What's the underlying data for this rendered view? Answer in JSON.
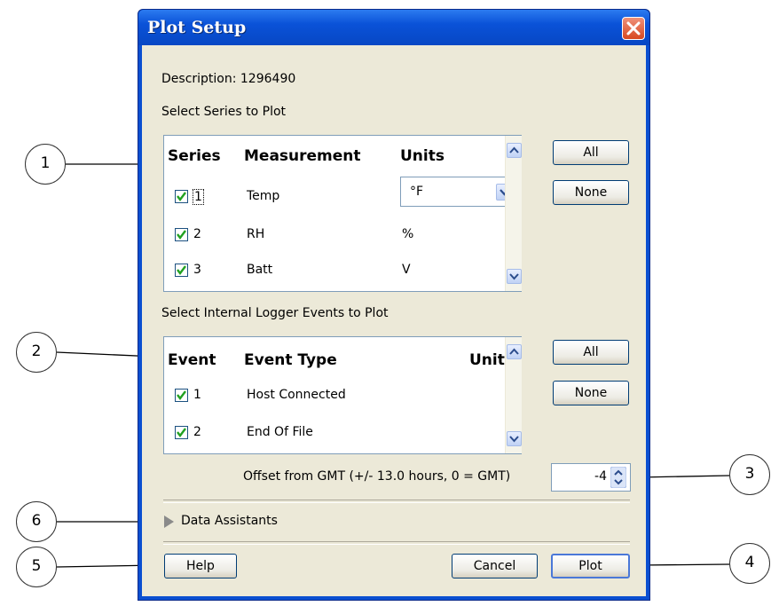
{
  "window": {
    "title": "Plot Setup"
  },
  "description": "Description: 1296490",
  "series_section": {
    "label": "Select Series to Plot",
    "headers": {
      "series": "Series",
      "measurement": "Measurement",
      "units": "Units"
    },
    "rows": [
      {
        "num": "1",
        "measurement": "Temp",
        "units": "°F",
        "checked": true
      },
      {
        "num": "2",
        "measurement": "RH",
        "units": "%",
        "checked": true
      },
      {
        "num": "3",
        "measurement": "Batt",
        "units": "V",
        "checked": true
      }
    ],
    "all_label": "All",
    "none_label": "None"
  },
  "events_section": {
    "label": "Select Internal Logger Events to Plot",
    "headers": {
      "event": "Event",
      "event_type": "Event Type",
      "units": "Units"
    },
    "rows": [
      {
        "num": "1",
        "event_type": "Host Connected",
        "checked": true
      },
      {
        "num": "2",
        "event_type": "End Of File",
        "checked": true
      }
    ],
    "all_label": "All",
    "none_label": "None"
  },
  "gmt_offset": {
    "label": "Offset from GMT (+/- 13.0 hours, 0 = GMT)",
    "value": "-4"
  },
  "data_assistants": {
    "label": "Data Assistants"
  },
  "buttons": {
    "help": "Help",
    "cancel": "Cancel",
    "plot": "Plot"
  },
  "callouts": [
    "1",
    "2",
    "3",
    "4",
    "5",
    "6"
  ],
  "colors": {
    "titlebar": "#0a52d8",
    "client": "#ece9d8",
    "check": "#21a121",
    "close": "#d84820"
  }
}
